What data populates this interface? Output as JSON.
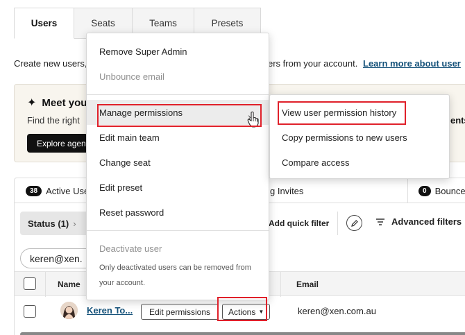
{
  "tabs": [
    {
      "label": "Users",
      "active": true
    },
    {
      "label": "Seats",
      "active": false
    },
    {
      "label": "Teams",
      "active": false
    },
    {
      "label": "Presets",
      "active": false
    }
  ],
  "intro": {
    "text_left": "Create new users,",
    "text_right": "ers from your account.",
    "link": "Learn more about user"
  },
  "banner": {
    "title": "Meet you",
    "text": "Find the right",
    "button": "Explore agent",
    "right_text": "ents"
  },
  "subtabs": {
    "active_count": "38",
    "active_label": "Active Use",
    "invites_label": "g Invites",
    "bounced_count": "0",
    "bounced_label": "Bounce"
  },
  "filters": {
    "status": "Status (1)",
    "quick": "Add quick filter",
    "advanced": "Advanced filters"
  },
  "search": {
    "value": "keren@xen."
  },
  "table": {
    "headers": {
      "name": "Name",
      "email": "Email"
    },
    "row": {
      "name": "Keren To...",
      "edit_button": "Edit permissions",
      "actions_button": "Actions",
      "email": "keren@xen.com.au"
    }
  },
  "menu": {
    "items": [
      {
        "label": "Remove Super Admin",
        "disabled": false
      },
      {
        "label": "Unbounce email",
        "disabled": true
      },
      {
        "label": "Manage permissions",
        "disabled": false,
        "highlighted": true
      },
      {
        "label": "Edit main team",
        "disabled": false
      },
      {
        "label": "Change seat",
        "disabled": false
      },
      {
        "label": "Edit preset",
        "disabled": false
      },
      {
        "label": "Reset password",
        "disabled": false
      },
      {
        "label": "Deactivate user",
        "disabled": true
      }
    ],
    "note": "Only deactivated users can be removed from your account."
  },
  "submenu": {
    "items": [
      {
        "label": "View user permission history"
      },
      {
        "label": "Copy permissions to new users"
      },
      {
        "label": "Compare access"
      }
    ]
  },
  "colors": {
    "highlight_red": "#e0202a",
    "link_blue": "#15527a",
    "banner_bg": "#f8f5ee"
  }
}
